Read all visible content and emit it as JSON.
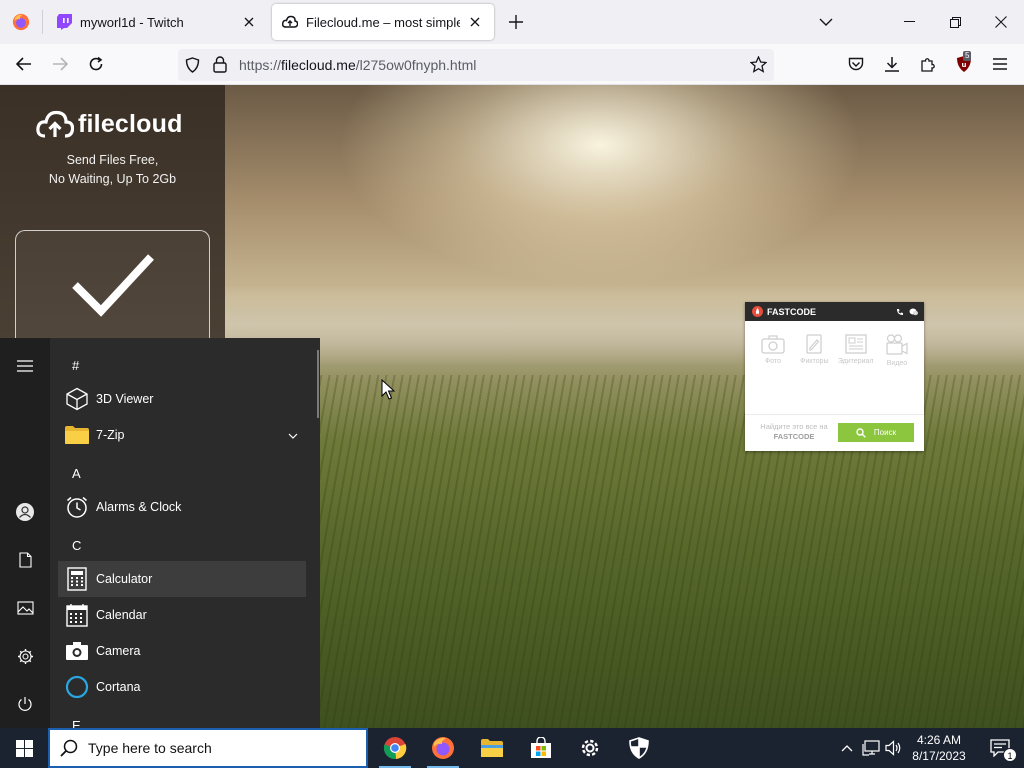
{
  "browser": {
    "tabs": [
      {
        "title": "myworl1d - Twitch",
        "active": false,
        "favicon": "twitch-icon"
      },
      {
        "title": "Filecloud.me – most simple file",
        "active": true,
        "favicon": "cloud-icon"
      }
    ],
    "url": {
      "scheme": "https://",
      "host": "filecloud.me",
      "path": "/l275ow0fnyph.html"
    },
    "extension_badge": "5"
  },
  "filecloud": {
    "logo_text": "filecloud",
    "tagline_line1": "Send Files Free,",
    "tagline_line2": "No Waiting, Up To 2Gb"
  },
  "fastcode_ad": {
    "brand": "FASTCODE",
    "tiles": [
      {
        "label": "Фото",
        "icon": "camera-icon"
      },
      {
        "label": "Фикторы",
        "icon": "edit-icon"
      },
      {
        "label": "Эдитериал",
        "icon": "news-icon"
      },
      {
        "label": "Видео",
        "icon": "video-icon"
      }
    ],
    "find_text": "Найдите это все на",
    "find_brand": "FASTCODE",
    "search_label": "Поиск"
  },
  "start_menu": {
    "groups": [
      {
        "letter": "#",
        "apps": [
          {
            "name": "3D Viewer",
            "icon": "cube-icon"
          },
          {
            "name": "7-Zip",
            "icon": "folder-icon",
            "expandable": true
          }
        ]
      },
      {
        "letter": "A",
        "apps": [
          {
            "name": "Alarms & Clock",
            "icon": "alarm-clock-icon"
          }
        ]
      },
      {
        "letter": "C",
        "apps": [
          {
            "name": "Calculator",
            "icon": "calculator-icon",
            "highlighted": true
          },
          {
            "name": "Calendar",
            "icon": "calendar-icon"
          },
          {
            "name": "Camera",
            "icon": "camera-icon"
          },
          {
            "name": "Cortana",
            "icon": "cortana-icon"
          }
        ]
      },
      {
        "letter": "E",
        "apps": []
      }
    ]
  },
  "taskbar": {
    "search_placeholder": "Type here to search",
    "pinned": [
      "chrome-icon",
      "firefox-icon",
      "file-explorer-icon",
      "store-icon",
      "settings-icon",
      "security-icon"
    ],
    "time": "4:26 AM",
    "date": "8/17/2023",
    "notification_count": "1"
  },
  "colors": {
    "tabstrip": "#f0f0f4",
    "taskbar": "#1c2330",
    "startmenu": "#2b2b2b",
    "fastcode_green": "#8cc63f",
    "search_border": "#1b5fae"
  }
}
